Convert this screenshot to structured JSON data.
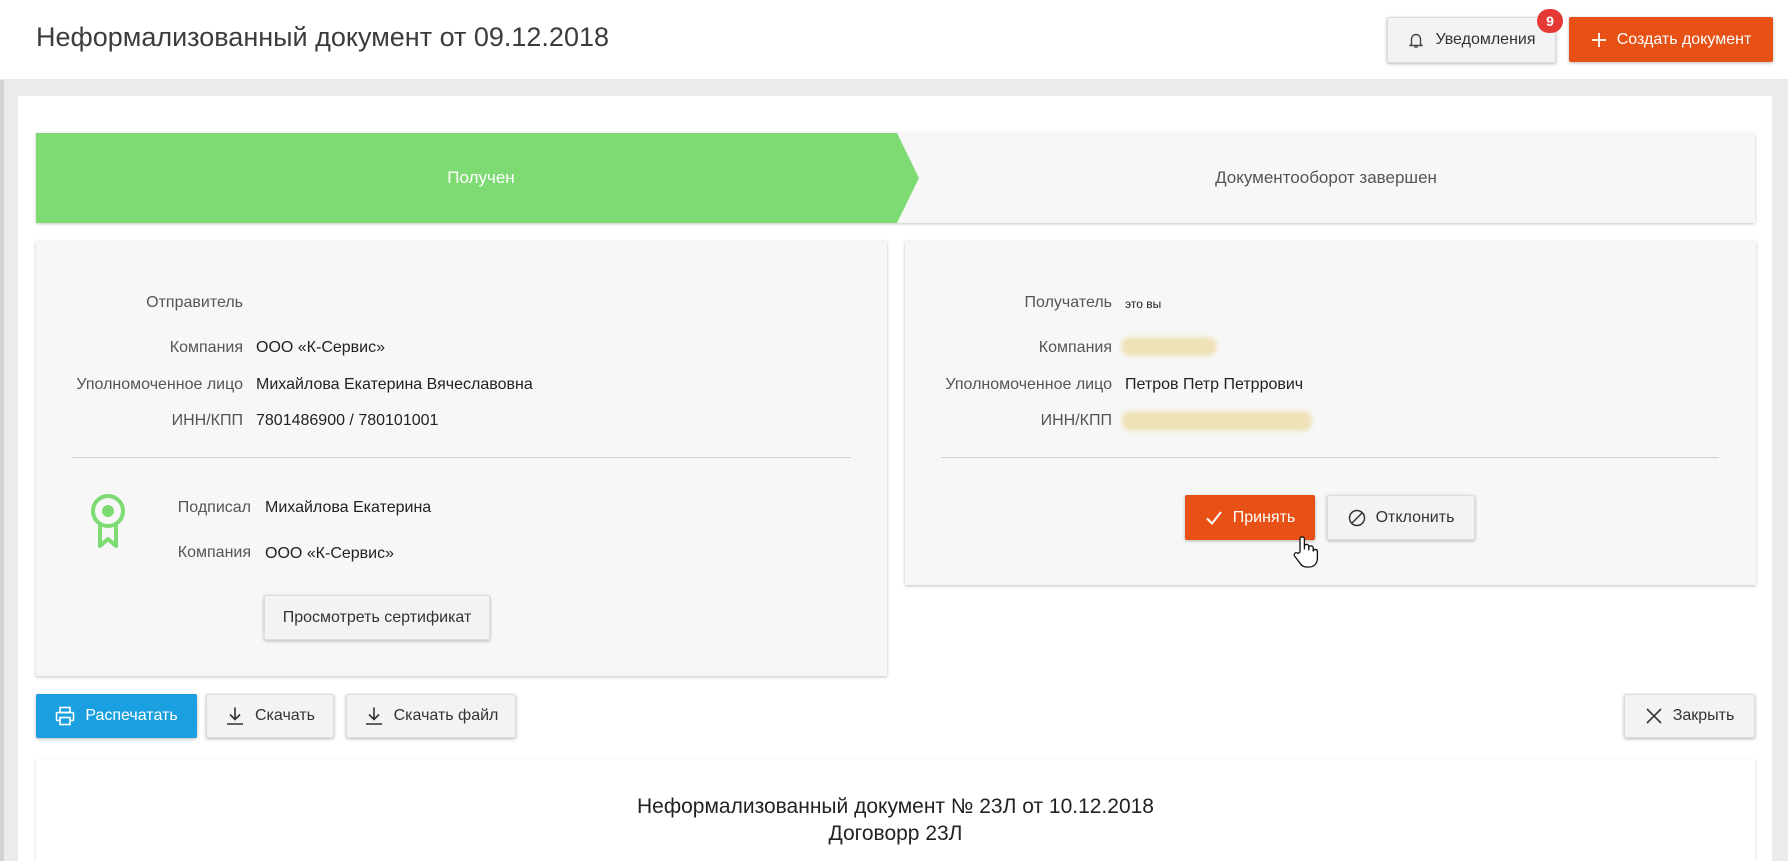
{
  "header": {
    "title": "Неформализованный документ от 09.12.2018",
    "notifications_label": "Уведомления",
    "notifications_count": "9",
    "create_label": "Создать документ"
  },
  "stepper": {
    "step1": "Получен",
    "step2": "Документооборот завершен"
  },
  "sender": {
    "heading": "Отправитель",
    "company_label": "Компания",
    "company": "ООО «К-Сервис»",
    "authorized_label": "Уполномоченное лицо",
    "authorized": "Михайлова Екатерина Вячеславовна",
    "inn_label": "ИНН/КПП",
    "inn": "7801486900 / 780101001",
    "signed_label": "Подписал",
    "signed": "Михайлова Екатерина",
    "signed_company_label": "Компания",
    "signed_company": "ООО «К-Сервис»",
    "view_cert_label": "Просмотреть сертификат"
  },
  "recipient": {
    "heading": "Получатель",
    "note": "это вы",
    "company_label": "Компания",
    "authorized_label": "Уполномоченное лицо",
    "authorized": "Петров Петр Петррович",
    "inn_label": "ИНН/КПП",
    "accept_label": "Принять",
    "reject_label": "Отклонить"
  },
  "toolbar": {
    "print_label": "Распечатать",
    "download_label": "Скачать",
    "download_file_label": "Скачать файл",
    "close_label": "Закрыть"
  },
  "document": {
    "line1": "Неформализованный документ № 23Л от 10.12.2018",
    "line2": "Договорр 23Л"
  },
  "colors": {
    "accent": "#e85116",
    "print": "#1aa0e0",
    "step_done": "#7edb73",
    "badge": "#e53935"
  }
}
